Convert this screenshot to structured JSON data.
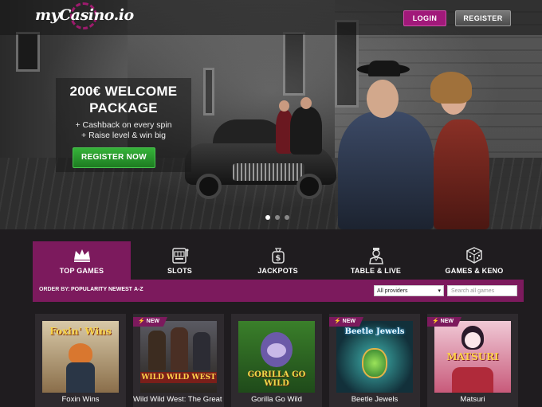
{
  "header": {
    "logo_text": "myCasino.io",
    "login_label": "LOGIN",
    "register_label": "REGISTER"
  },
  "promo": {
    "title": "200€ WELCOME PACKAGE",
    "line1": "+ Cashback on every spin",
    "line2": "+ Raise level & win big",
    "cta_label": "REGISTER NOW"
  },
  "carousel": {
    "slide_count": 3,
    "active_index": 0
  },
  "tabs": [
    {
      "label": "TOP GAMES",
      "icon": "crown-icon",
      "active": true
    },
    {
      "label": "SLOTS",
      "icon": "slot-machine-icon",
      "active": false
    },
    {
      "label": "JACKPOTS",
      "icon": "money-bag-icon",
      "active": false
    },
    {
      "label": "TABLE & LIVE",
      "icon": "dealer-icon",
      "active": false
    },
    {
      "label": "GAMES & KENO",
      "icon": "dice-icon",
      "active": false
    }
  ],
  "filters": {
    "order_by_label": "ORDER BY:",
    "options": [
      "POPULARITY",
      "NEWEST",
      "A-Z"
    ],
    "provider_selected": "All providers",
    "search_placeholder": "Search all games"
  },
  "games": [
    {
      "name": "Foxin Wins",
      "thumb_text": "Foxin' Wins",
      "is_new": false
    },
    {
      "name": "Wild Wild West: The Great Train Heist",
      "thumb_text": "WILD WILD WEST",
      "is_new": true
    },
    {
      "name": "Gorilla Go Wild",
      "thumb_text": "GORILLA GO WILD",
      "is_new": false
    },
    {
      "name": "Beetle Jewels",
      "thumb_text": "Beetle Jewels",
      "is_new": true
    },
    {
      "name": "Matsuri",
      "thumb_text": "MATSURI",
      "is_new": true
    }
  ],
  "badge_new_label": "NEW",
  "colors": {
    "brand_purple": "#7c1a5d",
    "login_purple": "#a1197a",
    "cta_green": "#2a9a2e",
    "page_bg": "#1f1c1f"
  }
}
